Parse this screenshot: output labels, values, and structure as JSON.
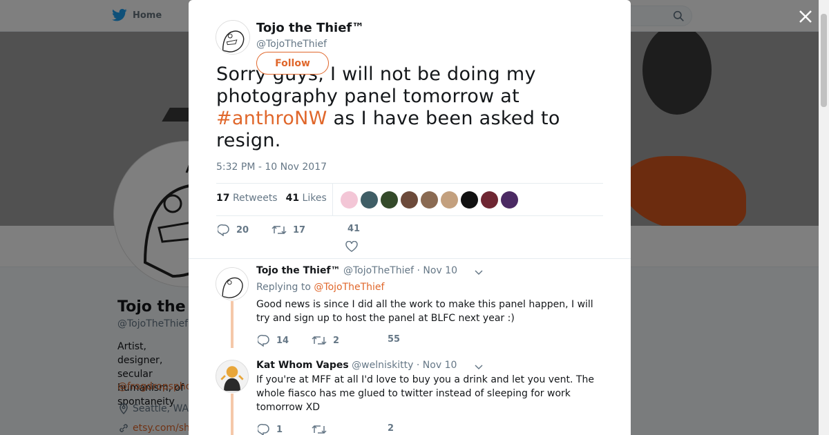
{
  "topbar": {
    "home_label": "Home"
  },
  "background_profile": {
    "name": "Tojo the",
    "handle": "@TojoTheThief",
    "bio": "Artist, designer, secular humanism, of spontaneity",
    "link": "@frogdropsphc",
    "location": "Seattle, WA",
    "website": "etsy.com/sh"
  },
  "tweet": {
    "author_name": "Tojo the Thief™",
    "author_handle": "@TojoTheThief",
    "follow_label": "Follow",
    "text_before": "Sorry guys, I will not be doing my photography panel tomorrow at ",
    "hashtag": "#anthroNW",
    "text_after": " as I have been asked to resign.",
    "timestamp": "5:32 PM - 10 Nov 2017",
    "retweet_count": "17",
    "retweet_label": "Retweets",
    "like_count": "41",
    "like_label": "Likes",
    "likers": [
      "#f3c6d6",
      "#3f5e66",
      "#344a2a",
      "#6c4a3a",
      "#8a6a52",
      "#c3a07e",
      "#111111",
      "#6e2632",
      "#4b2a63"
    ],
    "actions": {
      "replies": "20",
      "retweets": "17",
      "likes": "41"
    }
  },
  "replies": [
    {
      "name": "Tojo the Thief™",
      "handle": "@TojoTheThief",
      "date": "· Nov 10",
      "replying_prefix": "Replying to",
      "replying_to": "@TojoTheThief",
      "text": "Good news is since I did all the work to make this panel happen, I will try and sign up to host the panel at BLFC next year :)",
      "replies": "14",
      "retweets": "2",
      "likes": "55"
    },
    {
      "name": "Kat Whom Vapes",
      "handle": "@welniskitty",
      "date": "· Nov 10",
      "text": "If you're at MFF at all I'd love to buy you a drink and let you vent. The whole fiasco has me glued to twitter instead of sleeping for work tomorrow XD",
      "replies": "1",
      "retweets": "",
      "likes": "2"
    }
  ],
  "colors": {
    "accent": "#e0672b",
    "muted": "#657786",
    "thread": "#f5c8a9"
  }
}
